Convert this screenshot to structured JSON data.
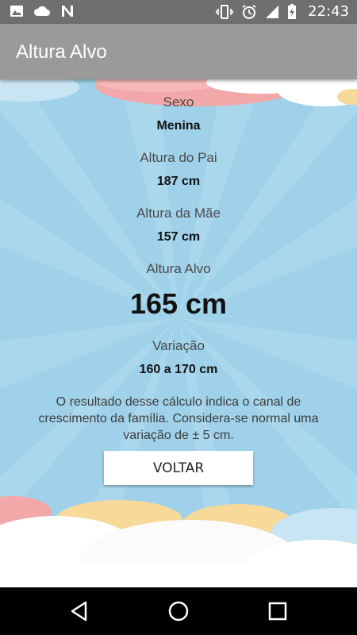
{
  "status_bar": {
    "time": "22:43",
    "icons": [
      "image-icon",
      "cloud-icon",
      "n-icon",
      "vibrate-icon",
      "alarm-icon",
      "signal-icon",
      "battery-charging-icon"
    ]
  },
  "app_bar": {
    "title": "Altura Alvo"
  },
  "result": {
    "sex_label": "Sexo",
    "sex_value": "Menina",
    "father_label": "Altura do Pai",
    "father_value": "187 cm",
    "mother_label": "Altura da Mãe",
    "mother_value": "157 cm",
    "target_label": "Altura Alvo",
    "target_value": "165 cm",
    "range_label": "Variação",
    "range_value": "160 a 170 cm",
    "note": "O resultado desse cálculo indica o canal de crescimento da família. Considera-se normal uma variação de ± 5 cm."
  },
  "buttons": {
    "back_label": "VOLTAR"
  },
  "nav_bar": {
    "icons": [
      "back-icon",
      "home-icon",
      "recents-icon"
    ]
  },
  "colors": {
    "sky": "#9fd2ea",
    "app_bar": "#9a9a9a",
    "cloud_pink": "#f2a7a8",
    "cloud_yellow": "#f7d99a"
  }
}
